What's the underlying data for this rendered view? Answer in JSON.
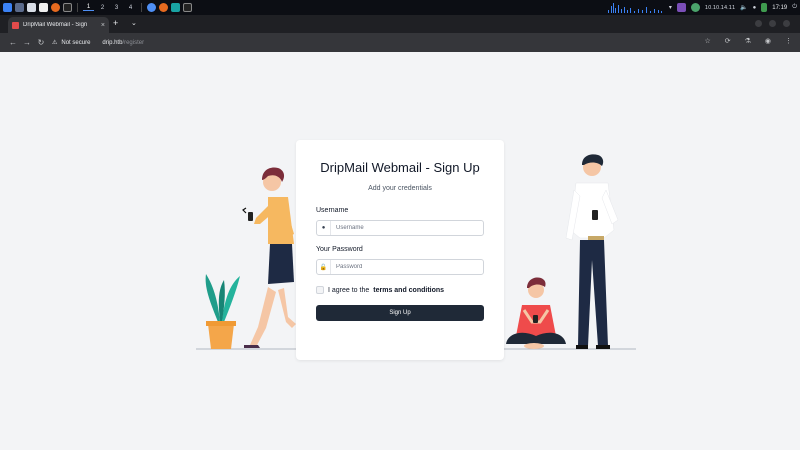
{
  "taskbar": {
    "workspaces": [
      "1",
      "2",
      "3",
      "4"
    ],
    "active_workspace": "1",
    "ip_address": "10.10.14.11",
    "clock": "17:19",
    "accent_color": "#3b82f6"
  },
  "browser": {
    "tab_title": "DripMail Webmail - Sign",
    "tab_close_icon": "×",
    "new_tab_icon": "+",
    "tab_list_icon": "⌄",
    "security_label": "Not secure",
    "url_host": "drip.htb",
    "url_path": "/register",
    "back_icon": "←",
    "forward_icon": "→",
    "reload_icon": "↻"
  },
  "form": {
    "title": "DripMail Webmail - Sign Up",
    "subtitle": "Add your credentials",
    "username_label": "Username",
    "username_placeholder": "Username",
    "password_label": "Your Password",
    "password_placeholder": "Password",
    "terms_prefix": "I agree to the",
    "terms_link": "terms and conditions",
    "submit_label": "Sign Up",
    "button_color": "#1f2937"
  }
}
